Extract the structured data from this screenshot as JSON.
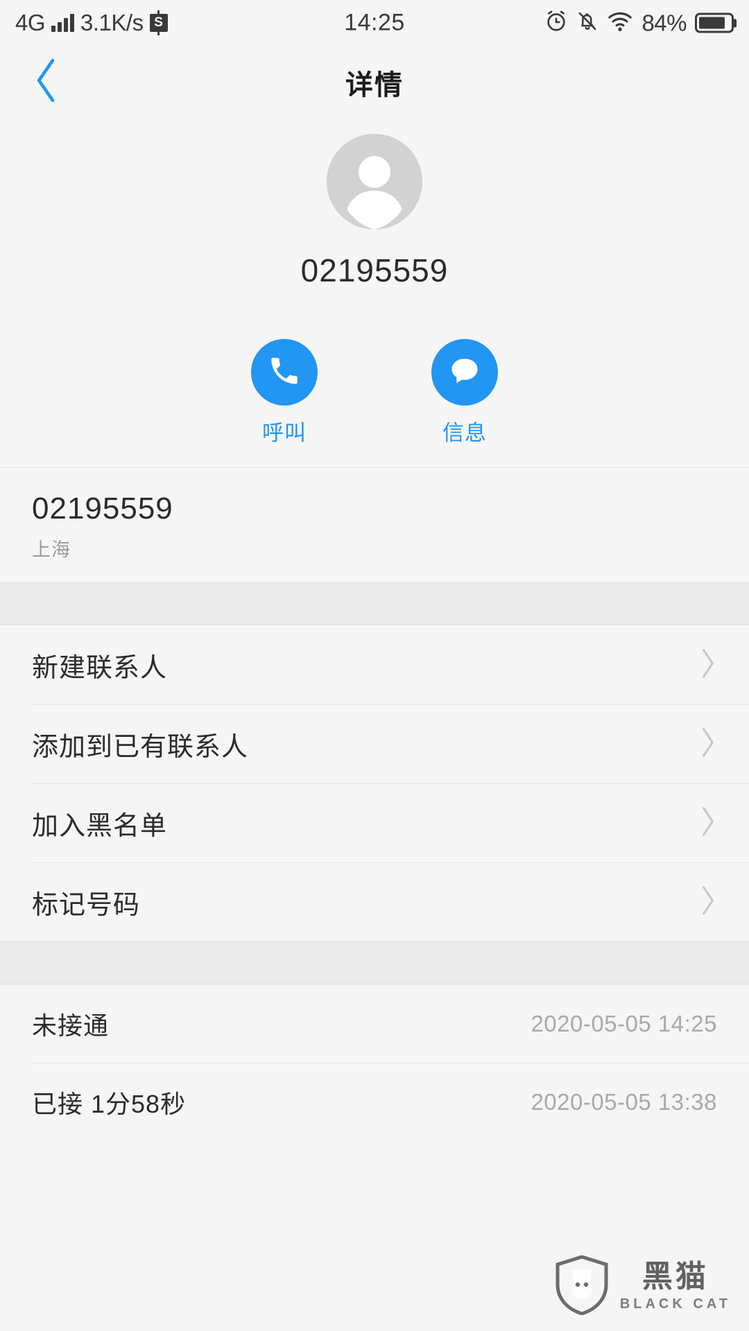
{
  "statusbar": {
    "network": "4G",
    "speed": "3.1K/s",
    "badge_icon_label": "S",
    "time": "14:25",
    "battery_percent": "84%",
    "battery_level": 84,
    "icons": [
      "signal-bars-icon",
      "s-badge-icon",
      "alarm-clock-icon",
      "bell-off-icon",
      "wifi-icon",
      "battery-icon"
    ]
  },
  "header": {
    "back_icon": "chevron-left-icon",
    "title": "详情"
  },
  "profile": {
    "avatar_icon": "default-person-avatar",
    "number": "02195559"
  },
  "actions": [
    {
      "label": "呼叫",
      "icon": "phone-icon"
    },
    {
      "label": "信息",
      "icon": "message-bubble-icon"
    }
  ],
  "number_block": {
    "number": "02195559",
    "location": "上海"
  },
  "menu": [
    {
      "label": "新建联系人",
      "chevron": "›"
    },
    {
      "label": "添加到已有联系人",
      "chevron": "›"
    },
    {
      "label": "加入黑名单",
      "chevron": "›"
    },
    {
      "label": "标记号码",
      "chevron": "›"
    }
  ],
  "history": [
    {
      "type": "未接通",
      "time": "2020-05-05 14:25"
    },
    {
      "type": "已接 1分58秒",
      "time": "2020-05-05 13:38"
    }
  ],
  "watermark": {
    "cn": "黑猫",
    "en": "BLACK CAT",
    "icon": "black-cat-shield-logo"
  },
  "colors": {
    "accent": "#2196f3",
    "background": "#f5f5f5",
    "divider": "#e4e4e4",
    "muted_text": "#a9a9a9"
  }
}
